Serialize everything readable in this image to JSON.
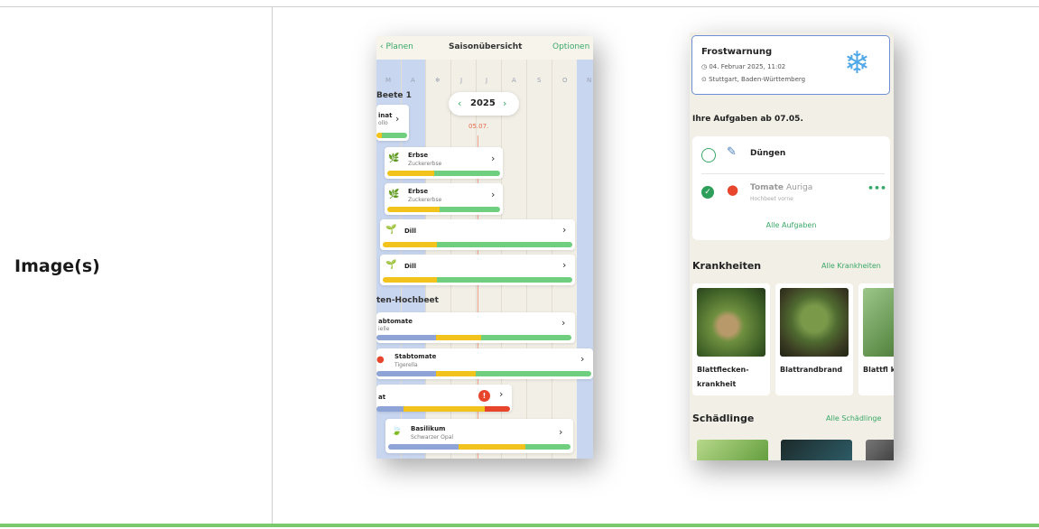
{
  "row_label": "Image(s)",
  "screen1": {
    "header": {
      "back": "‹ Planen",
      "title": "Saisonübersicht",
      "options": "Optionen"
    },
    "months": [
      "M",
      "A",
      "❄",
      "J",
      "J",
      "A",
      "S",
      "O",
      "N"
    ],
    "year": "2025",
    "today": "05.07.",
    "section1": "Beete 1",
    "section2": "ten-Hochbeet",
    "cards": [
      {
        "name": "inat",
        "variety": "ollo"
      },
      {
        "name": "Erbse",
        "variety": "Zuckererbse"
      },
      {
        "name": "Erbse",
        "variety": "Zuckererbse"
      },
      {
        "name": "Dill",
        "variety": ""
      },
      {
        "name": "Dill",
        "variety": ""
      },
      {
        "name": "abtomate",
        "variety": "ielle"
      },
      {
        "name": "Stabtomate",
        "variety": "Tigerella"
      },
      {
        "name": "at",
        "variety": "",
        "alert": "!"
      },
      {
        "name": "Basilikum",
        "variety": "Schwarzer Opal"
      }
    ],
    "colors": {
      "blue": "#8ea4d6",
      "yellow": "#f2c31d",
      "green": "#6fcf7f",
      "red": "#e8462c"
    }
  },
  "screen2": {
    "frost": {
      "title": "Frostwarnung",
      "datetime": "04. Februar 2025, 11:02",
      "location": "Stuttgart, Baden-Württemberg"
    },
    "tasks_heading": "Ihre Aufgaben ab 07.05.",
    "tasks": [
      {
        "name": "Düngen",
        "variety": "",
        "location": "",
        "done": false
      },
      {
        "name": "Tomate",
        "variety": "Auriga",
        "location": "Hochbeet vorne",
        "done": true
      }
    ],
    "all_tasks": "Alle Aufgaben",
    "diseases_heading": "Krankheiten",
    "diseases_link": "Alle Krankheiten",
    "diseases": [
      "Blattflecken-krankheit",
      "Blattrandbrand",
      "Blattfl krankl"
    ],
    "pests_heading": "Schädlinge",
    "pests_link": "Alle Schädlinge"
  }
}
